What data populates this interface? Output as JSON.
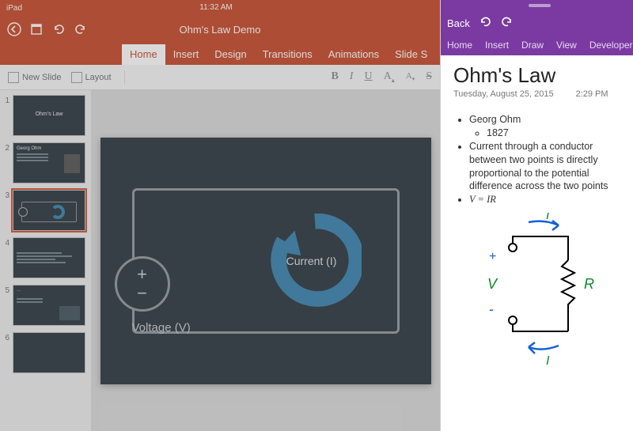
{
  "statusbar": {
    "device": "iPad",
    "time": "11:32 AM"
  },
  "powerpoint": {
    "doc_title": "Ohm's Law Demo",
    "tabs": [
      "Home",
      "Insert",
      "Design",
      "Transitions",
      "Animations",
      "Slide S"
    ],
    "active_tab_index": 0,
    "ribbon": {
      "new_slide": "New Slide",
      "layout": "Layout",
      "bold": "B",
      "italic": "I",
      "underline": "U",
      "font_shrink": "A",
      "font_grow": "A",
      "strike": "S"
    },
    "slides": [
      {
        "num": "1",
        "title": "Ohm's Law"
      },
      {
        "num": "2",
        "title": "Georg Ohm"
      },
      {
        "num": "3",
        "title": ""
      },
      {
        "num": "4",
        "title": ""
      },
      {
        "num": "5",
        "title": ""
      },
      {
        "num": "6",
        "title": ""
      }
    ],
    "selected_slide_index": 2,
    "canvas": {
      "voltage_label": "Voltage (V)",
      "current_label": "Current (I)",
      "plus": "+",
      "minus": "−"
    },
    "colors": {
      "brand": "#c43e1c",
      "slide_bg": "#1e2a33",
      "accent": "#2b7aa9"
    }
  },
  "onenote": {
    "back": "Back",
    "tabs": [
      "Home",
      "Insert",
      "Draw",
      "View",
      "Developer"
    ],
    "page_title": "Ohm's Law",
    "date": "Tuesday, August 25, 2015",
    "time": "2:29 PM",
    "bullets": {
      "b1": "Georg Ohm",
      "b1a": "1827",
      "b2": "Current through a conductor between two points is directly proportional to the potential difference across the two points",
      "b3": "V = IR"
    },
    "sketch_labels": {
      "I_top": "I",
      "I_bot": "I",
      "V": "V",
      "R": "R",
      "plus": "+",
      "minus": "-"
    },
    "colors": {
      "brand": "#7b3aa1"
    }
  }
}
